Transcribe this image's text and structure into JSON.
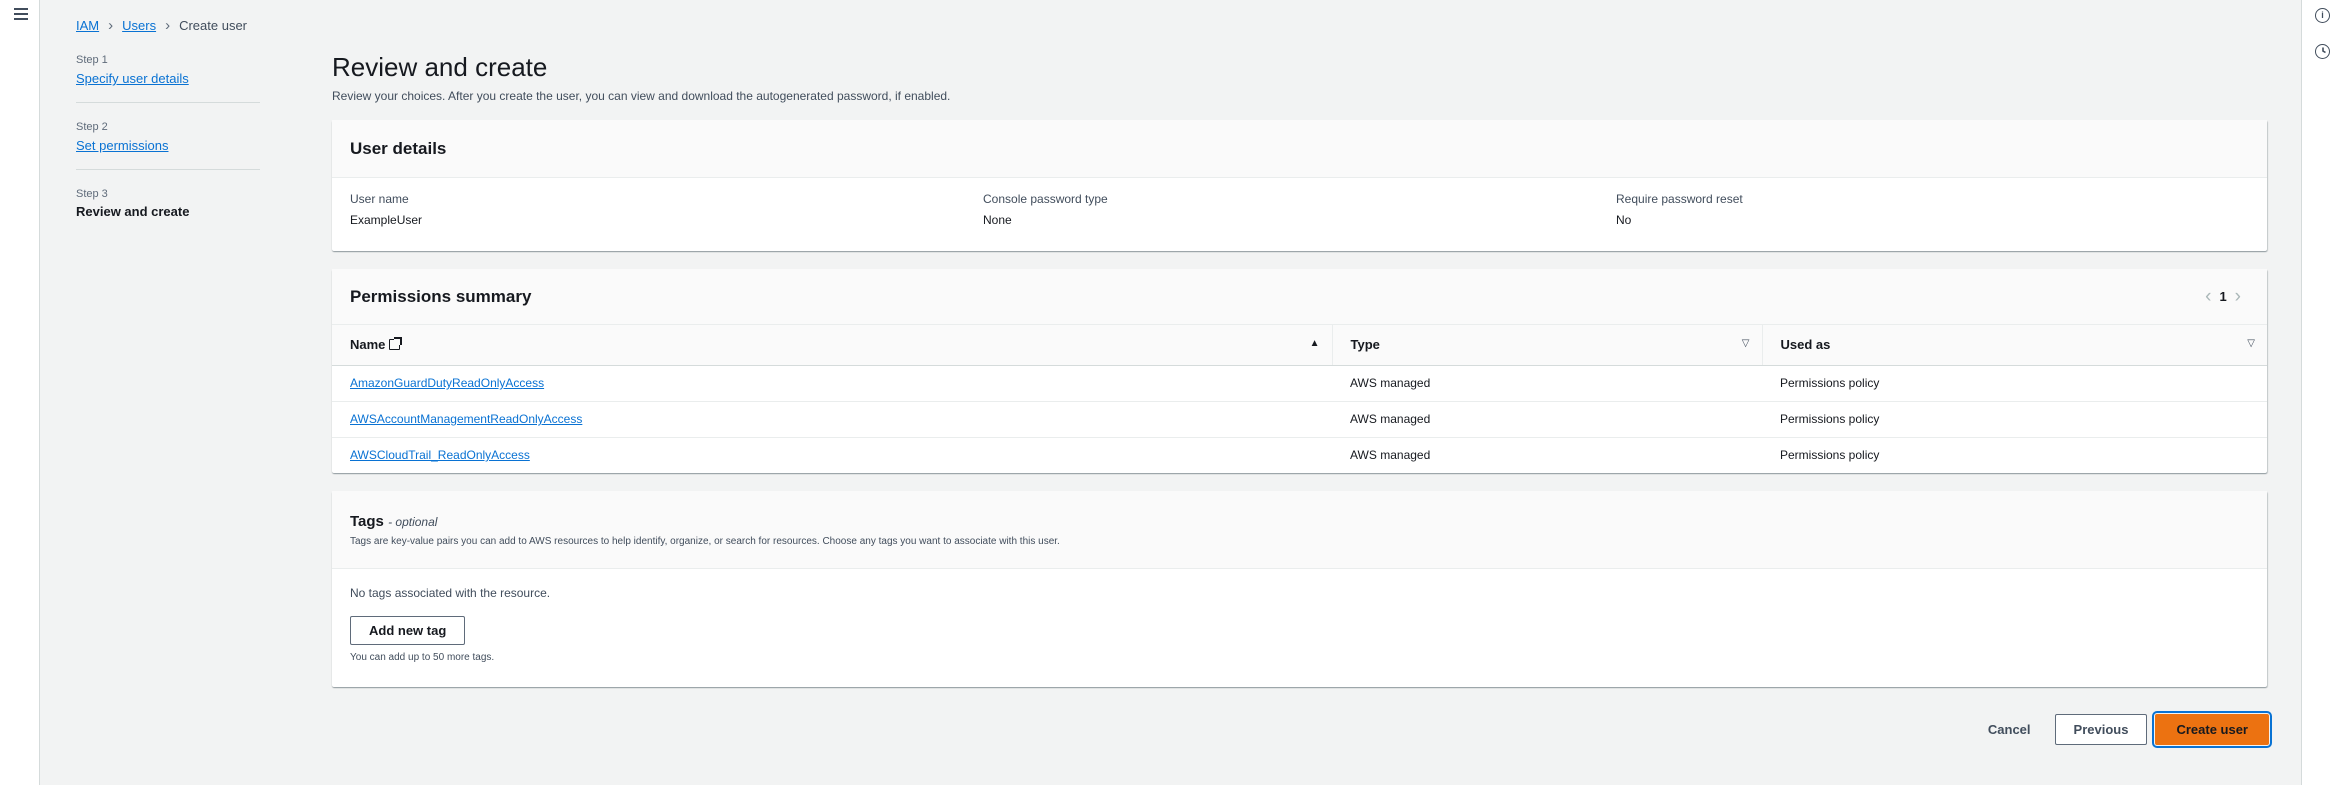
{
  "breadcrumb": {
    "iam": "IAM",
    "users": "Users",
    "current": "Create user"
  },
  "steps": [
    {
      "num": "Step 1",
      "label": "Specify user details"
    },
    {
      "num": "Step 2",
      "label": "Set permissions"
    },
    {
      "num": "Step 3",
      "label": "Review and create"
    }
  ],
  "page": {
    "title": "Review and create",
    "description": "Review your choices. After you create the user, you can view and download the autogenerated password, if enabled."
  },
  "user_details": {
    "title": "User details",
    "fields": [
      {
        "key": "User name",
        "value": "ExampleUser"
      },
      {
        "key": "Console password type",
        "value": "None"
      },
      {
        "key": "Require password reset",
        "value": "No"
      }
    ]
  },
  "permissions": {
    "title": "Permissions summary",
    "page": "1",
    "columns": {
      "name": "Name",
      "type": "Type",
      "used_as": "Used as"
    },
    "rows": [
      {
        "name": "AmazonGuardDutyReadOnlyAccess",
        "type": "AWS managed",
        "used_as": "Permissions policy"
      },
      {
        "name": "AWSAccountManagementReadOnlyAccess",
        "type": "AWS managed",
        "used_as": "Permissions policy"
      },
      {
        "name": "AWSCloudTrail_ReadOnlyAccess",
        "type": "AWS managed",
        "used_as": "Permissions policy"
      }
    ]
  },
  "tags": {
    "title": "Tags",
    "optional": "- optional",
    "description": "Tags are key-value pairs you can add to AWS resources to help identify, organize, or search for resources. Choose any tags you want to associate with this user.",
    "empty": "No tags associated with the resource.",
    "add_label": "Add new tag",
    "hint": "You can add up to 50 more tags."
  },
  "actions": {
    "cancel": "Cancel",
    "previous": "Previous",
    "create": "Create user"
  },
  "colors": {
    "primary": "#ec7211",
    "link": "#0972d3",
    "focus": "#0972d3"
  },
  "icons": {
    "menu": "hamburger-icon",
    "info": "info-icon",
    "clock": "clock-icon",
    "external": "external-link-icon",
    "sort": "sort-icon",
    "prev": "chevron-left-icon",
    "next": "chevron-right-icon"
  }
}
